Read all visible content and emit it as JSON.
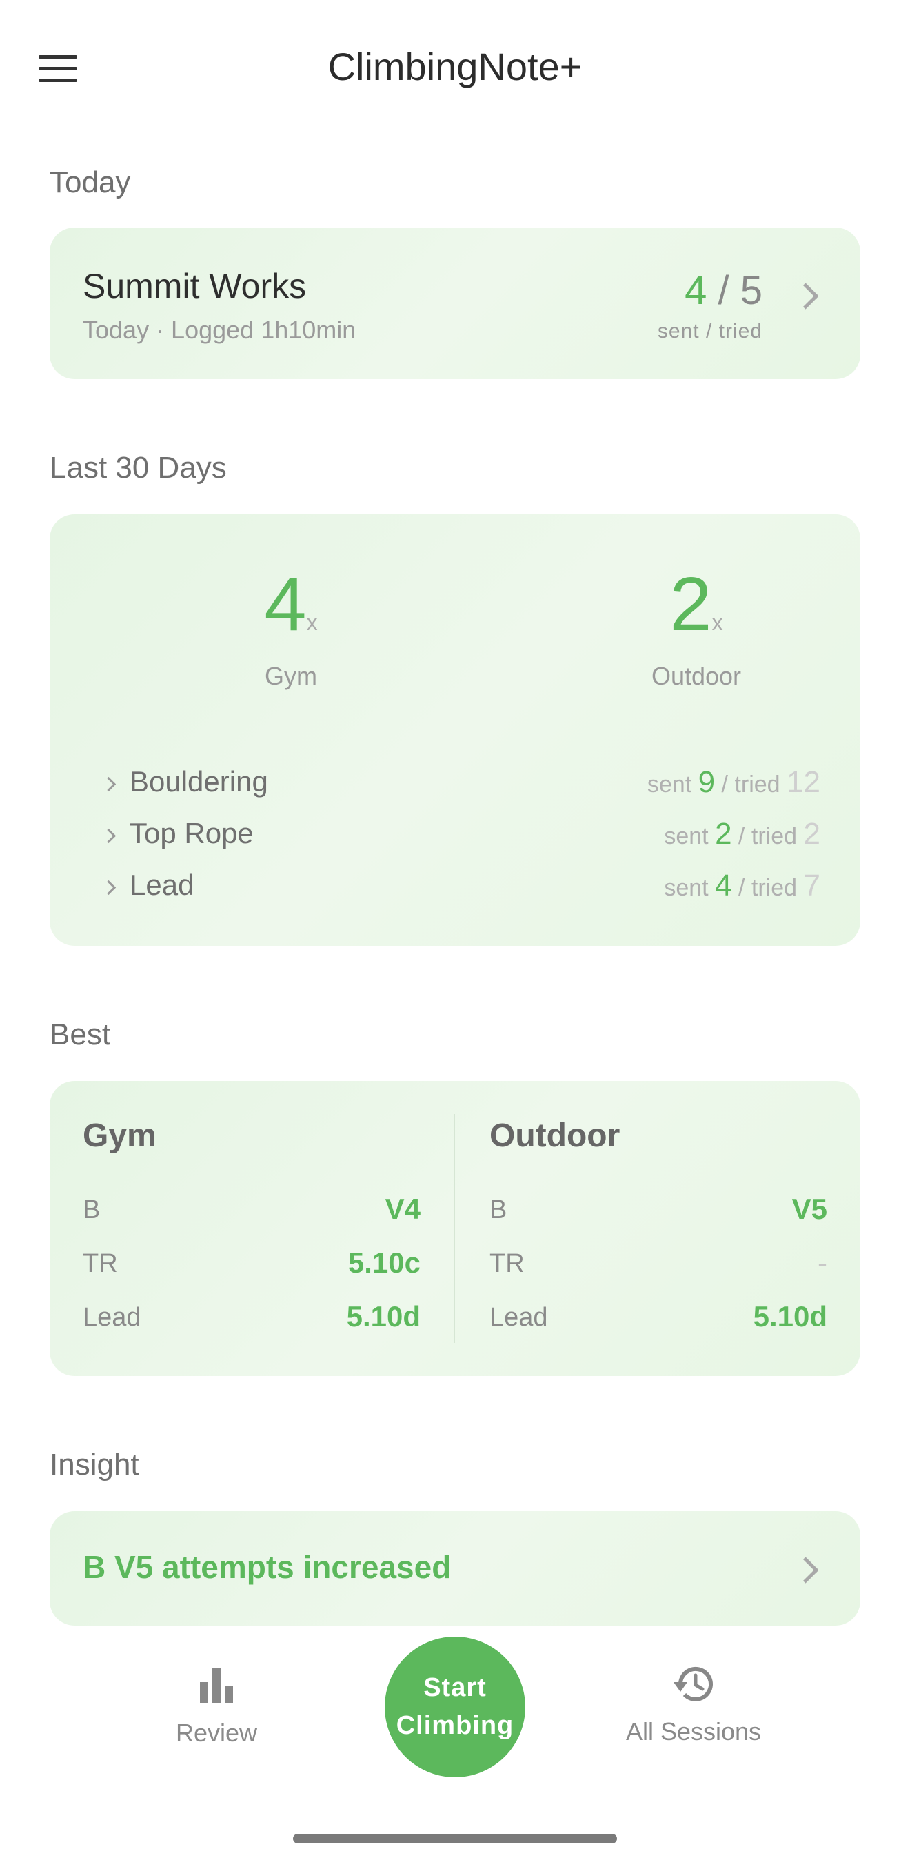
{
  "header": {
    "title": "ClimbingNote+",
    "menu_icon": "hamburger-menu-icon"
  },
  "today": {
    "section_label": "Today",
    "gym_name": "Summit Works",
    "subtitle": "Today · Logged 1h10min",
    "sent": "4",
    "separator": "/",
    "tried": "5",
    "caption": "sent / tried"
  },
  "last30": {
    "section_label": "Last 30 Days",
    "gym": {
      "count": "4",
      "unit": "x",
      "label": "Gym"
    },
    "outdoor": {
      "count": "2",
      "unit": "x",
      "label": "Outdoor"
    },
    "disciplines": [
      {
        "name": "Bouldering",
        "sent_label": "sent",
        "sent": "9",
        "tried_label": "/ tried",
        "tried": "12"
      },
      {
        "name": "Top Rope",
        "sent_label": "sent",
        "sent": "2",
        "tried_label": "/ tried",
        "tried": "2"
      },
      {
        "name": "Lead",
        "sent_label": "sent",
        "sent": "4",
        "tried_label": "/ tried",
        "tried": "7"
      }
    ]
  },
  "best": {
    "section_label": "Best",
    "gym": {
      "title": "Gym",
      "rows": [
        {
          "label": "B",
          "value": "V4"
        },
        {
          "label": "TR",
          "value": "5.10c"
        },
        {
          "label": "Lead",
          "value": "5.10d"
        }
      ]
    },
    "outdoor": {
      "title": "Outdoor",
      "rows": [
        {
          "label": "B",
          "value": "V5"
        },
        {
          "label": "TR",
          "value": "-"
        },
        {
          "label": "Lead",
          "value": "5.10d"
        }
      ]
    }
  },
  "insight": {
    "section_label": "Insight",
    "text": "B V5 attempts increased"
  },
  "nav": {
    "review": "Review",
    "start_line1": "Start",
    "start_line2": "Climbing",
    "sessions": "All Sessions"
  },
  "colors": {
    "accent": "#5cb85c",
    "card_bg": "#e9f6e7"
  }
}
